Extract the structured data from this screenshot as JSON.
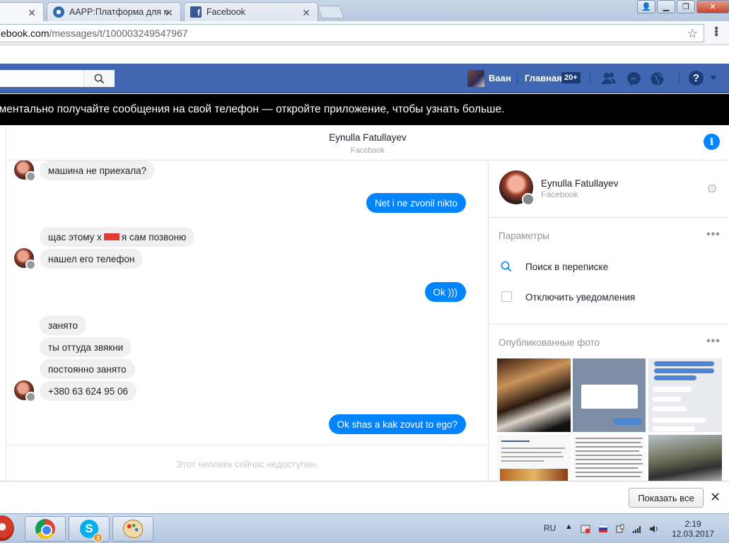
{
  "browser": {
    "tabs": [
      {
        "label": "",
        "active": true
      },
      {
        "label": "AAPP:Платформа для м",
        "active": false
      },
      {
        "label": "Facebook",
        "active": false
      }
    ],
    "url_domain": "ebook.com",
    "url_path": "/messages/t/100003249547967"
  },
  "fb_header": {
    "user_name": "Ваан",
    "home_label": "Главная",
    "home_badge": "20+",
    "help_label": "?"
  },
  "banner": {
    "text": "оментально получайте сообщения на свой телефон — откройте приложение, чтобы узнать больше."
  },
  "conversation": {
    "name": "Eynulla Fatullayev",
    "subtitle": "Facebook",
    "messages": [
      {
        "dir": "in",
        "text": "машина не приехала?"
      },
      {
        "dir": "out",
        "text": "Net i ne zvonil nikto"
      },
      {
        "dir": "in",
        "text_before": "щас этому х",
        "text_after": " я сам позвоню"
      },
      {
        "dir": "in",
        "text": "нашел его телефон"
      },
      {
        "dir": "out",
        "text": "Ok )))"
      },
      {
        "dir": "in",
        "text": "занято"
      },
      {
        "dir": "in",
        "text": "ты оттуда звякни"
      },
      {
        "dir": "in",
        "text": "постоянно занято"
      },
      {
        "dir": "in",
        "text": "+380 63 624 95 06"
      },
      {
        "dir": "out",
        "text": "Ok shas a kak zovut to ego?"
      }
    ],
    "composer_placeholder": "Этот человек сейчас недоступен."
  },
  "right_panel": {
    "name": "Eynulla Fatullayev",
    "subtitle": "Facebook",
    "params_title": "Параметры",
    "search_label": "Поиск в переписке",
    "mute_label": "Отключить уведомления",
    "photos_title": "Опубликованные фото",
    "more": "•••"
  },
  "download_bar": {
    "show_all": "Показать все",
    "close": "✕"
  },
  "taskbar": {
    "skype_badge": "3",
    "lang": "RU",
    "time": "2:19",
    "date": "12.03.2017"
  },
  "colors": {
    "fb_blue": "#4267b2",
    "messenger_blue": "#0084ff",
    "bubble_gray": "#f1f0f0"
  }
}
